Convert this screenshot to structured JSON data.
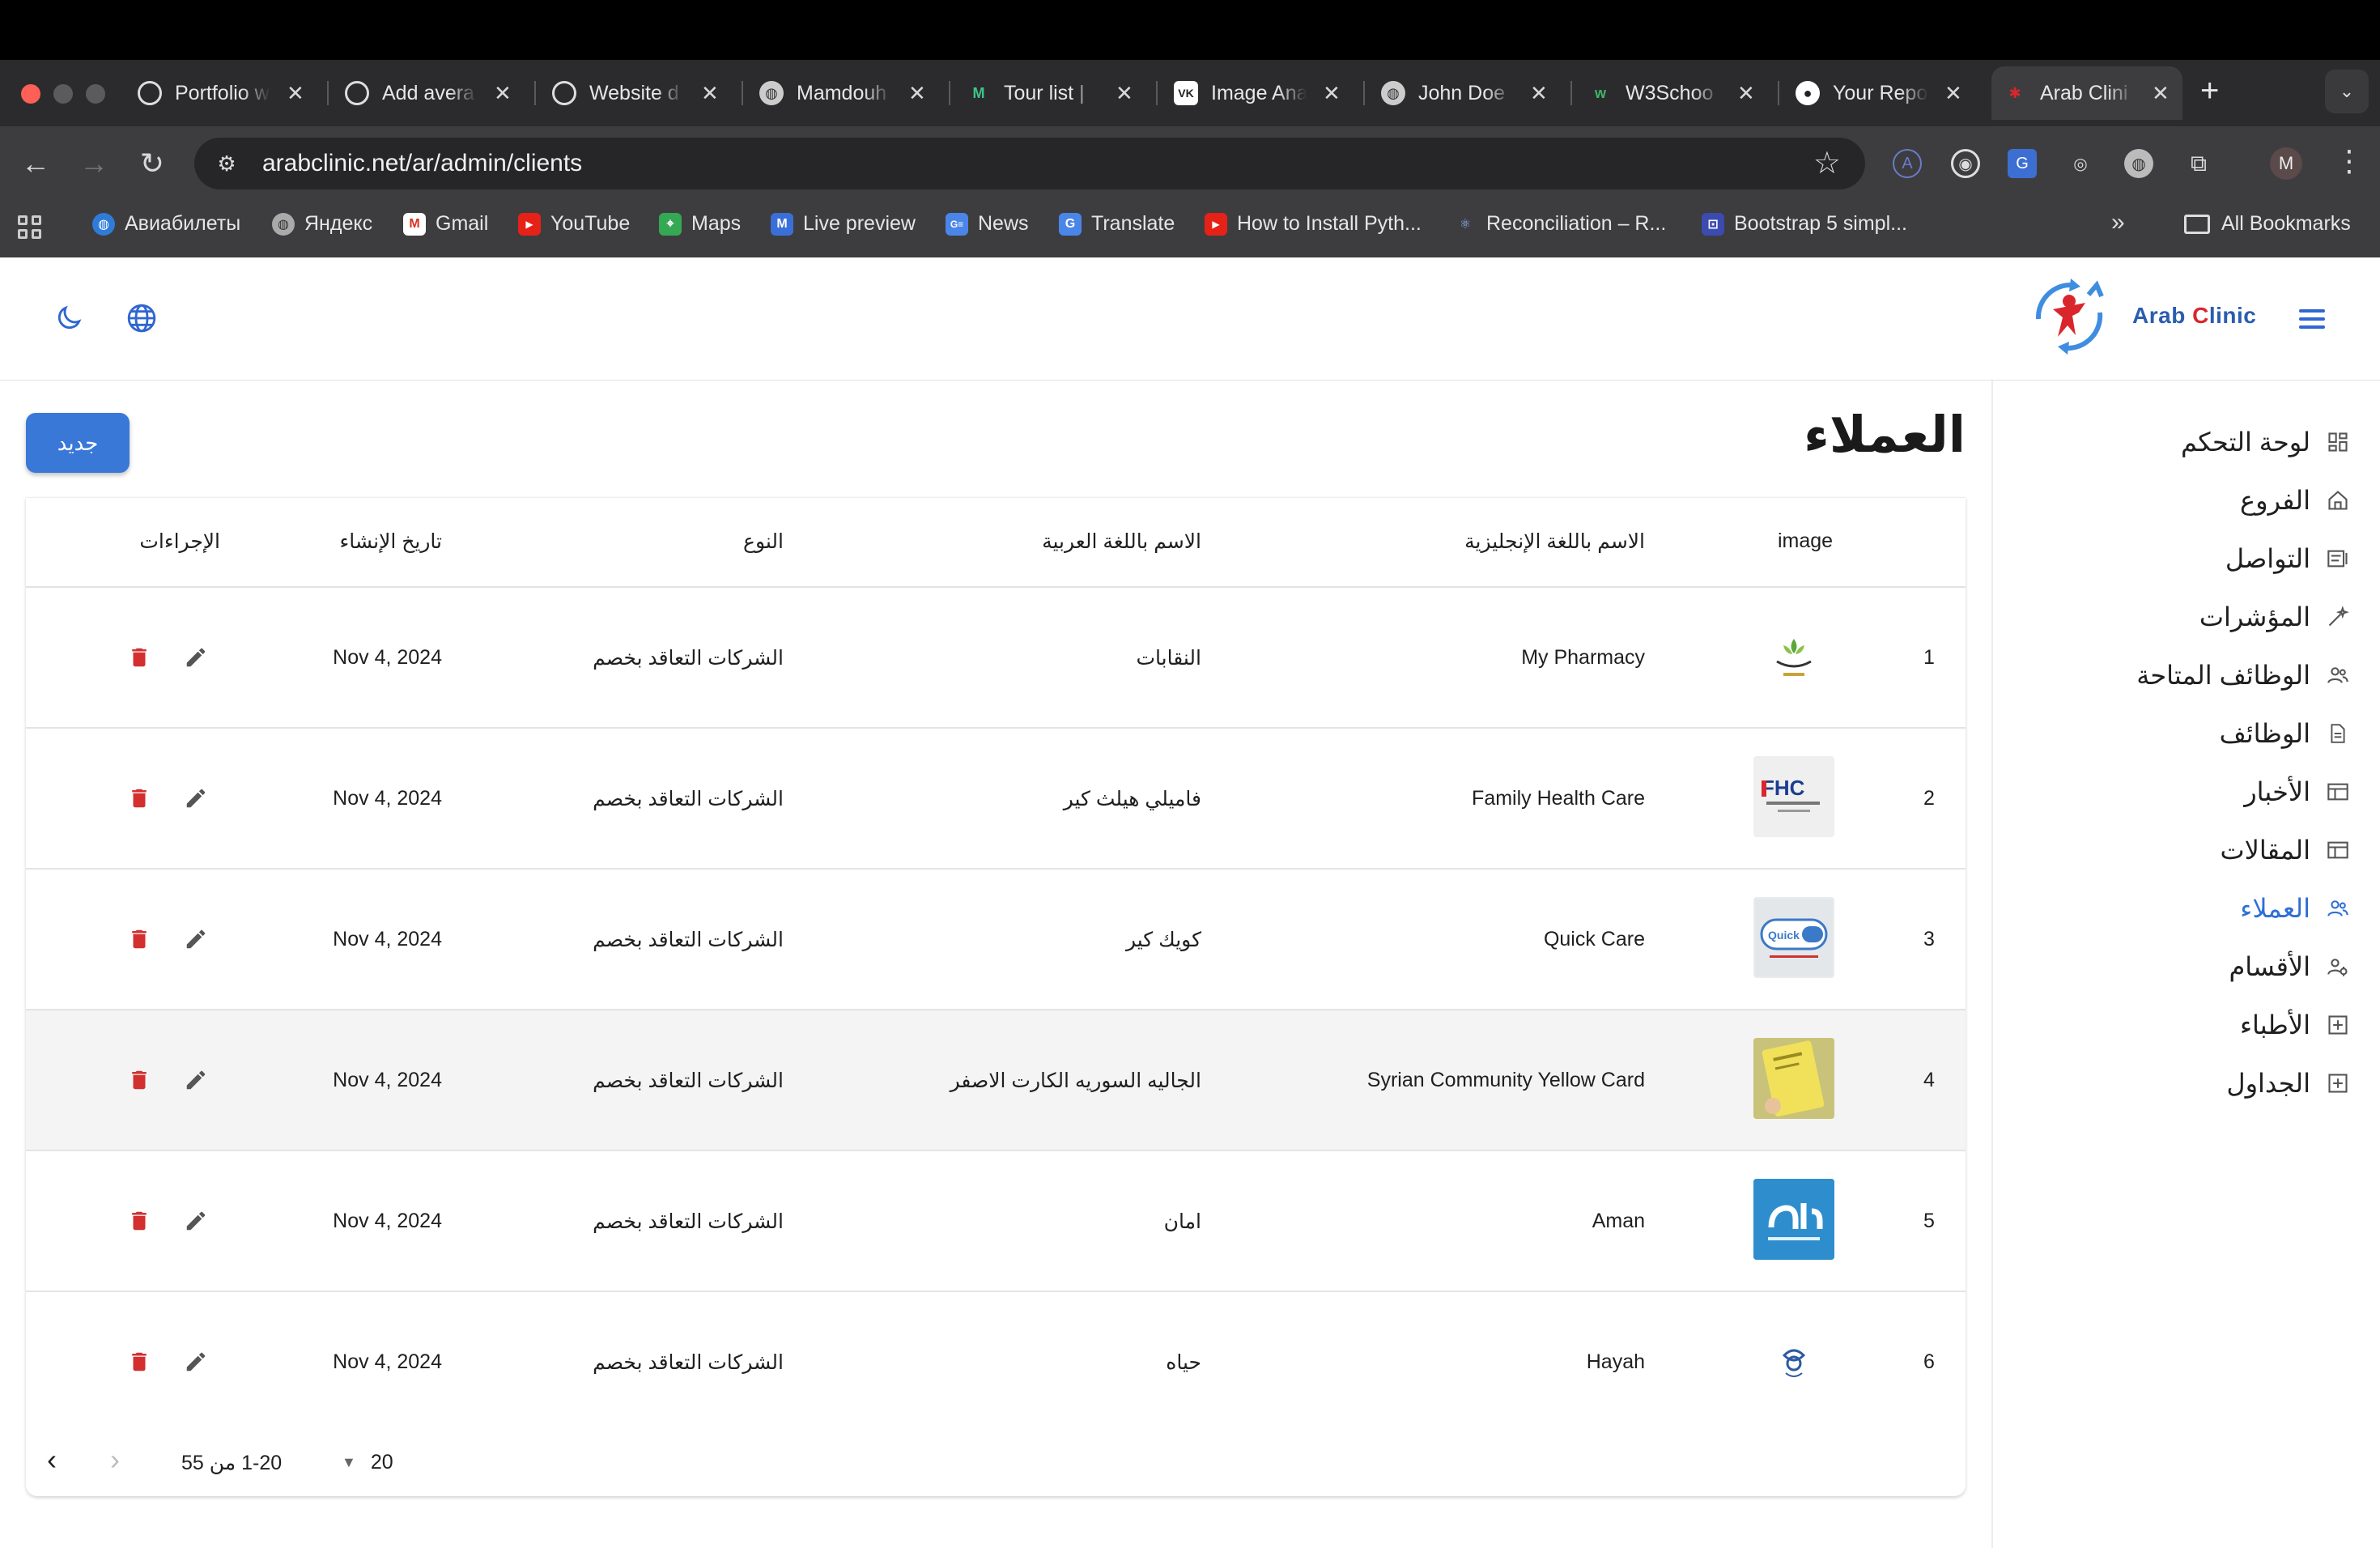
{
  "browser": {
    "tabs": [
      {
        "title": "Portfolio w",
        "icon": "openai-icon"
      },
      {
        "title": "Add avera",
        "icon": "openai-icon"
      },
      {
        "title": "Website d",
        "icon": "openai-icon"
      },
      {
        "title": "Mamdouh",
        "icon": "globe-icon"
      },
      {
        "title": "Tour list | ",
        "icon": "tour-icon"
      },
      {
        "title": "Image Ana",
        "icon": "vk-icon"
      },
      {
        "title": "John Doe",
        "icon": "globe-icon"
      },
      {
        "title": "W3Schoo",
        "icon": "w3schools-icon"
      },
      {
        "title": "Your Repo",
        "icon": "github-icon"
      },
      {
        "title": "Arab Clini",
        "icon": "arab-clinic-icon",
        "active": true
      }
    ],
    "url": "arabclinic.net/ar/admin/clients",
    "avatar_letter": "M",
    "bookmarks": [
      "Авиабилеты",
      "Яндекс",
      "Gmail",
      "YouTube",
      "Maps",
      "Live preview",
      "News",
      "Translate",
      "How to Install Pyth...",
      "Reconciliation – R...",
      "Bootstrap 5 simpl..."
    ],
    "all_bookmarks": "All Bookmarks"
  },
  "header": {
    "logo_text_1": "Arab ",
    "logo_text_c": "C",
    "logo_text_2": "linic"
  },
  "sidebar": {
    "items": [
      {
        "label": "لوحة التحكم",
        "icon": "dashboard-icon"
      },
      {
        "label": "الفروع",
        "icon": "home-icon"
      },
      {
        "label": "التواصل",
        "icon": "contact-icon"
      },
      {
        "label": "المؤشرات",
        "icon": "magic-wand-icon"
      },
      {
        "label": "الوظائف المتاحة",
        "icon": "people-icon"
      },
      {
        "label": "الوظائف",
        "icon": "document-icon"
      },
      {
        "label": "الأخبار",
        "icon": "newspaper-icon"
      },
      {
        "label": "المقالات",
        "icon": "article-icon"
      },
      {
        "label": "العملاء",
        "icon": "clients-icon",
        "active": true
      },
      {
        "label": "الأقسام",
        "icon": "departments-icon"
      },
      {
        "label": "الأطباء",
        "icon": "plus-box-icon"
      },
      {
        "label": "الجداول",
        "icon": "plus-box-icon"
      }
    ]
  },
  "page": {
    "title": "العملاء",
    "new_button": "جديد"
  },
  "table": {
    "headers": {
      "image": "image",
      "name_en": "الاسم باللغة الإنجليزية",
      "name_ar": "الاسم باللغة العربية",
      "type": "النوع",
      "created": "تاريخ الإنشاء",
      "actions": "الإجراءات"
    },
    "rows": [
      {
        "n": "1",
        "name_en": "My Pharmacy",
        "name_ar": "النقابات",
        "type": "الشركات التعاقد بخصم",
        "created": "Nov 4, 2024"
      },
      {
        "n": "2",
        "name_en": "Family Health Care",
        "name_ar": "فاميلي هيلث كير",
        "type": "الشركات التعاقد بخصم",
        "created": "Nov 4, 2024"
      },
      {
        "n": "3",
        "name_en": "Quick Care",
        "name_ar": "كويك كير",
        "type": "الشركات التعاقد بخصم",
        "created": "Nov 4, 2024"
      },
      {
        "n": "4",
        "name_en": "Syrian Community Yellow Card",
        "name_ar": "الجاليه السوريه الكارت الاصفر",
        "type": "الشركات التعاقد بخصم",
        "created": "Nov 4, 2024"
      },
      {
        "n": "5",
        "name_en": "Aman",
        "name_ar": "امان",
        "type": "الشركات التعاقد بخصم",
        "created": "Nov 4, 2024"
      },
      {
        "n": "6",
        "name_en": "Hayah",
        "name_ar": "حياه",
        "type": "الشركات التعاقد بخصم",
        "created": "Nov 4, 2024"
      }
    ]
  },
  "pagination": {
    "range": "1-20 من 55",
    "per_page": "20"
  },
  "colors": {
    "accent": "#3a78d8",
    "delete": "#d32f2f",
    "chrome_dark": "#3d3d40"
  }
}
